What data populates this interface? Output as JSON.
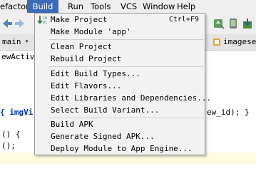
{
  "menubar": {
    "items": [
      "efactor",
      "Build",
      "Run",
      "Tools",
      "VCS",
      "Window",
      "Help"
    ]
  },
  "tabs": {
    "left": "main",
    "right": "imagese"
  },
  "editor": {
    "lines": {
      "l1": "ewActiv",
      "l2": "{ imgVi",
      "l2_right": "ew_id); }",
      "l3": "() {",
      "l4": "();"
    }
  },
  "build_menu": {
    "make_project": "Make Project",
    "make_project_shortcut": "Ctrl+F9",
    "make_module": "Make Module 'app'",
    "clean_project": "Clean Project",
    "rebuild_project": "Rebuild Project",
    "edit_build_types": "Edit Build Types...",
    "edit_flavors": "Edit Flavors...",
    "edit_libraries": "Edit Libraries and Dependencies...",
    "select_build_variant": "Select Build Variant...",
    "build_apk": "Build APK",
    "generate_signed_apk": "Generate Signed APK...",
    "deploy_module": "Deploy Module to App Engine..."
  },
  "colors": {
    "menu_highlight": "#3c6ab8",
    "menu_background": "#f2f2f2"
  }
}
